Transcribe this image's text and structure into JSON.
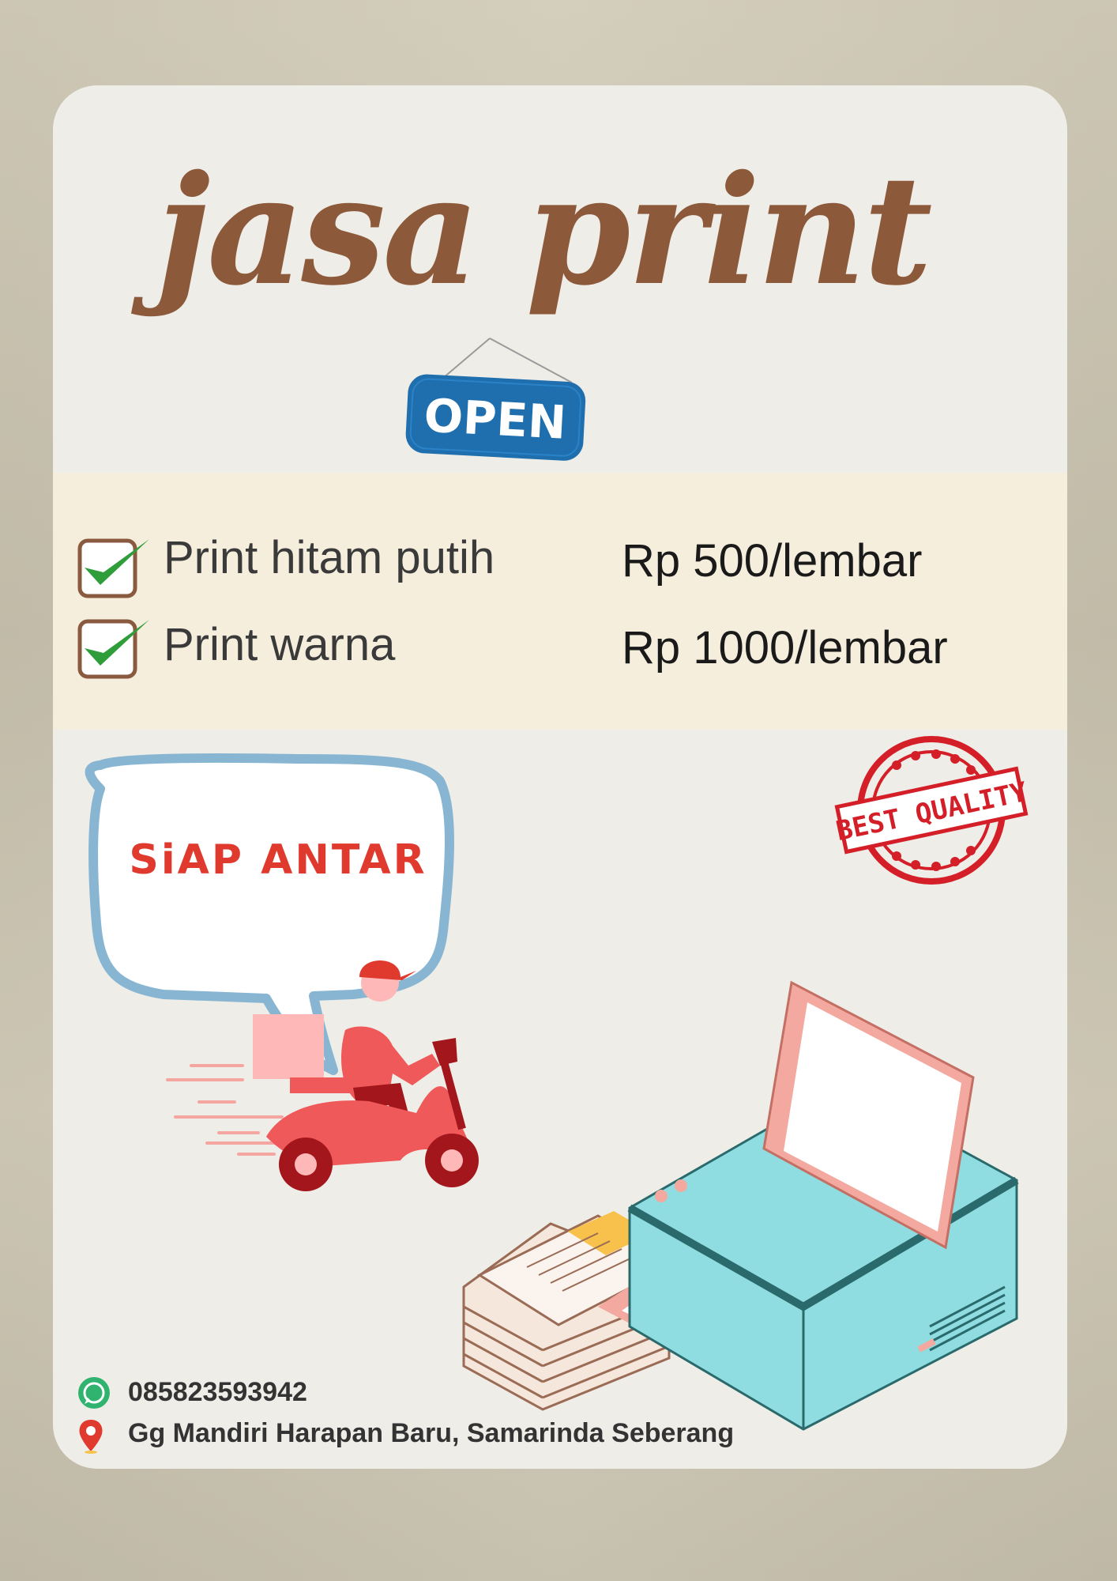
{
  "poster": {
    "title": "jasa print",
    "sign_label": "OPEN",
    "services": [
      {
        "label": "Print hitam putih",
        "price": "Rp 500/lembar"
      },
      {
        "label": "Print warna",
        "price": "Rp 1000/lembar"
      }
    ],
    "delivery_label": "SiAP  ANTAR",
    "badge_label": "BEST QUALITY",
    "contact": {
      "phone": "085823593942",
      "address": "Gg Mandiri Harapan Baru, Samarinda Seberang"
    }
  },
  "colors": {
    "title": "#8c5a3a",
    "sign": "#1f6fae",
    "band": "#f6eedc",
    "accent_red": "#e0392d",
    "printer": "#8fdde0",
    "printer_pink": "#f3a99f",
    "check_green": "#2e9d3a"
  },
  "icons": [
    "check-icon",
    "whatsapp-icon",
    "location-pin-icon",
    "scooter-courier-icon",
    "printer-icon",
    "stamp-icon"
  ]
}
